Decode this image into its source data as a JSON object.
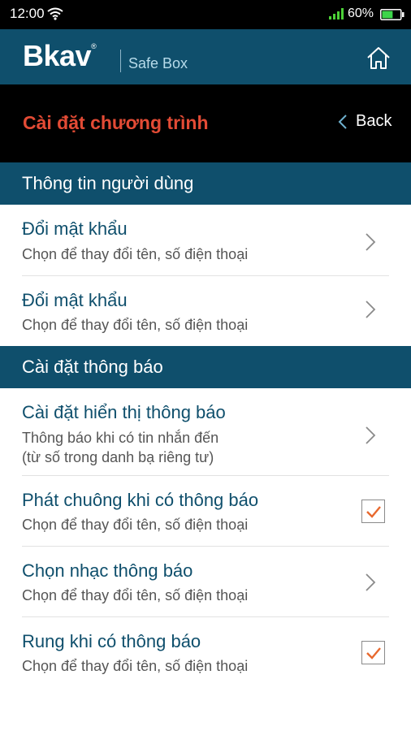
{
  "status_bar": {
    "time": "12:00",
    "battery_percent": "60%",
    "battery_level": 0.6,
    "wifi_icon": "wifi-icon",
    "signal_icon": "cellular-signal-icon",
    "battery_icon": "battery-icon"
  },
  "app_header": {
    "brand": "Bkav",
    "brand_mark": "®",
    "product": "Safe Box",
    "home_icon": "home-icon"
  },
  "title_bar": {
    "title": "Cài đặt chương trình",
    "back_label": "Back",
    "back_icon": "chevron-left-icon"
  },
  "sections": [
    {
      "header": "Thông tin người dùng",
      "items": [
        {
          "title": "Đổi mật khẩu",
          "subtitle": "Chọn để thay đổi tên, số điện thoại",
          "control": "chevron"
        },
        {
          "title": "Đổi mật khẩu",
          "subtitle": "Chọn để thay đổi tên, số điện thoại",
          "control": "chevron"
        }
      ]
    },
    {
      "header": "Cài đặt thông báo",
      "items": [
        {
          "title": "Cài đặt hiển thị thông báo",
          "subtitle_line1": "Thông báo khi có tin nhắn đến",
          "subtitle_line2": "(từ số trong danh bạ riêng tư)",
          "control": "chevron"
        },
        {
          "title": "Phát chuông khi có thông báo",
          "subtitle": "Chọn để thay đổi tên, số điện thoại",
          "control": "checkbox",
          "checked": true
        },
        {
          "title": "Chọn nhạc thông báo",
          "subtitle": "Chọn để thay đổi tên, số điện thoại",
          "control": "chevron"
        },
        {
          "title": "Rung khi có thông báo",
          "subtitle": "Chọn để thay đổi tên, số điện thoại",
          "control": "checkbox",
          "checked": true
        }
      ]
    }
  ],
  "colors": {
    "header_blue": "#0f4f6c",
    "title_red": "#e34b35",
    "check_orange": "#e8692e",
    "battery_green": "#3dd44a",
    "signal_green": "#4cd137"
  }
}
